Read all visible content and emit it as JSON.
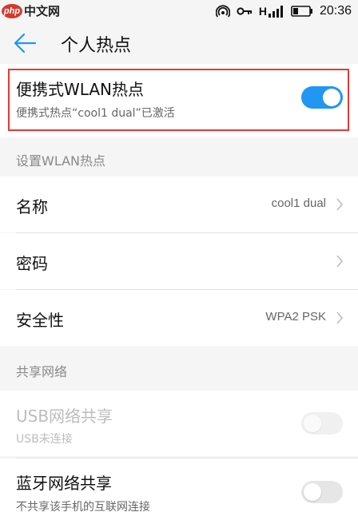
{
  "status_bar": {
    "watermark_badge": "php",
    "watermark_text": "中文网",
    "signal_label": "H",
    "time": "20:36",
    "icons": [
      "hotspot-icon",
      "key-icon",
      "signal-icon",
      "battery-icon"
    ]
  },
  "header": {
    "title": "个人热点",
    "back_icon": "back-arrow-icon"
  },
  "hotspot": {
    "title": "便携式WLAN热点",
    "subtitle": "便携式热点“cool1 dual”已激活",
    "enabled": true
  },
  "setup_section": {
    "header": "设置WLAN热点",
    "items": [
      {
        "label": "名称",
        "value": "cool1 dual"
      },
      {
        "label": "密码",
        "value": ""
      },
      {
        "label": "安全性",
        "value": "WPA2 PSK"
      }
    ]
  },
  "share_section": {
    "header": "共享网络",
    "items": [
      {
        "title": "USB网络共享",
        "subtitle": "USB未连接",
        "enabled": false,
        "disabled": true
      },
      {
        "title": "蓝牙网络共享",
        "subtitle": "不共享该手机的互联网连接",
        "enabled": false,
        "disabled": false
      }
    ]
  },
  "colors": {
    "accent": "#2196f3",
    "highlight_frame": "#e53935",
    "background": "#f5f5f5"
  }
}
